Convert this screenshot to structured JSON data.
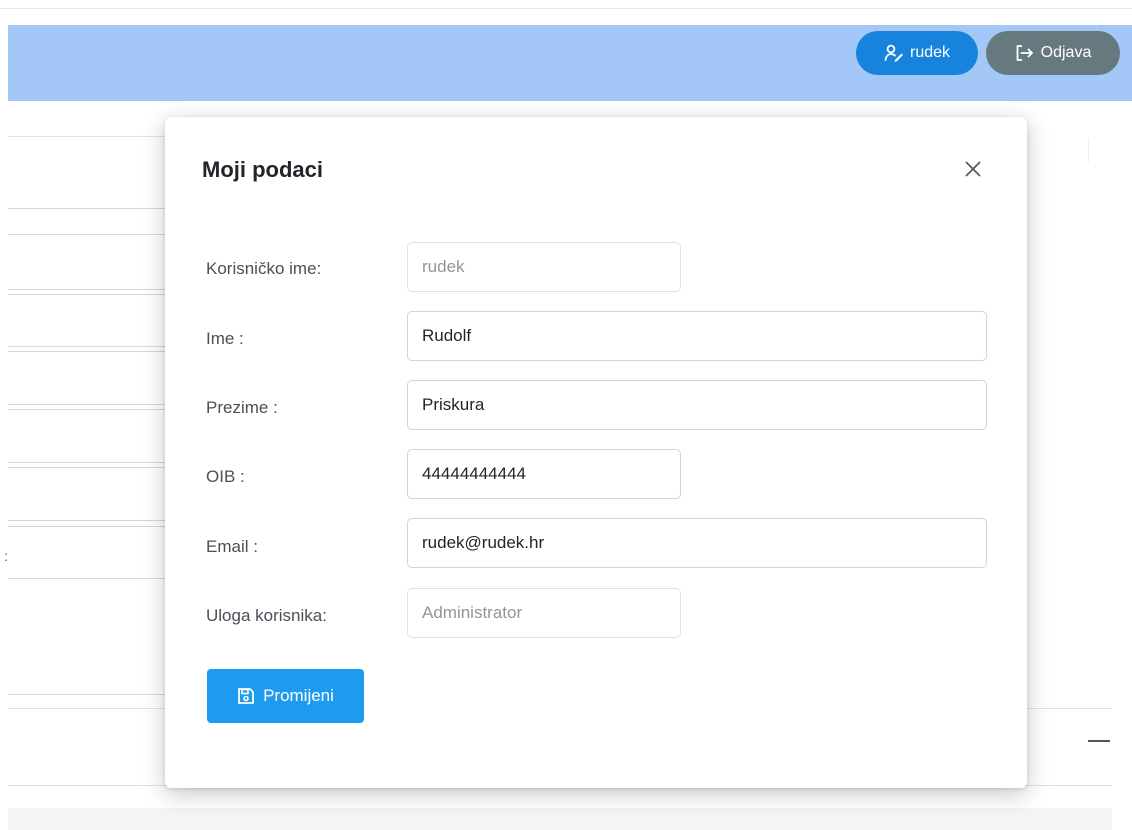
{
  "header": {
    "user_button_label": "rudek",
    "logout_button_label": "Odjava"
  },
  "modal": {
    "title": "Moji podaci",
    "fields": {
      "username": {
        "label": "Korisničko ime:",
        "value": "rudek"
      },
      "first_name": {
        "label": "Ime :",
        "value": "Rudolf"
      },
      "last_name": {
        "label": "Prezime :",
        "value": "Priskura"
      },
      "oib": {
        "label": "OIB :",
        "value": "44444444444"
      },
      "email": {
        "label": "Email :",
        "value": "rudek@rudek.hr"
      },
      "role": {
        "label": "Uloga korisnika:",
        "value": "Administrator"
      }
    },
    "save_button_label": "Promijeni"
  },
  "background": {
    "colon_text": ":"
  },
  "icons": {
    "user": "user-edit-icon",
    "logout": "logout-icon",
    "close": "close-icon",
    "save": "floppy-disk-icon"
  },
  "colors": {
    "navbar": "#a3c8f7",
    "user_button": "#1883dd",
    "logout_button": "#66797f",
    "save_button": "#1e9bf0"
  }
}
